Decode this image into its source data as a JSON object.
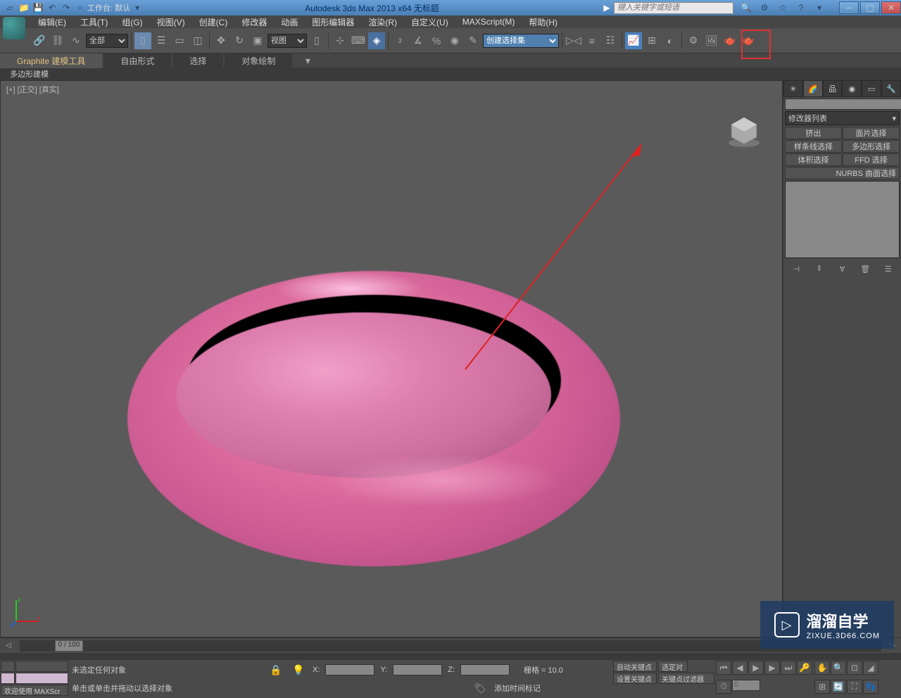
{
  "title_bar": {
    "workspace_label": "工作台: 默认",
    "app_title": "Autodesk 3ds Max  2013 x64     无标题",
    "search_placeholder": "键入关键字或短语"
  },
  "menu": {
    "items": [
      "编辑(E)",
      "工具(T)",
      "组(G)",
      "视图(V)",
      "创建(C)",
      "修改器",
      "动画",
      "图形编辑器",
      "渲染(R)",
      "自定义(U)",
      "MAXScript(M)",
      "帮助(H)"
    ]
  },
  "toolbar": {
    "filter_select": "全部",
    "view_select": "视图",
    "selection_set": "创建选择集"
  },
  "ribbon": {
    "tabs": [
      "Graphite 建模工具",
      "自由形式",
      "选择",
      "对象绘制"
    ],
    "sub": "多边形建模"
  },
  "viewport": {
    "label": "[+] [正交] [真实]"
  },
  "cmd_panel": {
    "modifier_list": "修改器列表",
    "buttons": [
      "挤出",
      "面片选择",
      "样条线选择",
      "多边形选择",
      "体积选择",
      "FFD 选择",
      "NURBS 曲面选择"
    ]
  },
  "timeline": {
    "frame": "0 / 100"
  },
  "status": {
    "no_selection": "未选定任何对象",
    "hint": "单击或单击并拖动以选择对象",
    "welcome": "欢迎使用   MAXScr",
    "x": "X:",
    "y": "Y:",
    "z": "Z:",
    "grid": "栅格 = 10.0",
    "add_time_tag": "添加时间标记",
    "auto_key": "自动关键点",
    "set_key": "设置关键点",
    "selected": "选定对",
    "key_filter": "关键点过滤器"
  },
  "watermark": {
    "title": "溜溜自学",
    "url": "ZIXUE.3D66.COM"
  }
}
